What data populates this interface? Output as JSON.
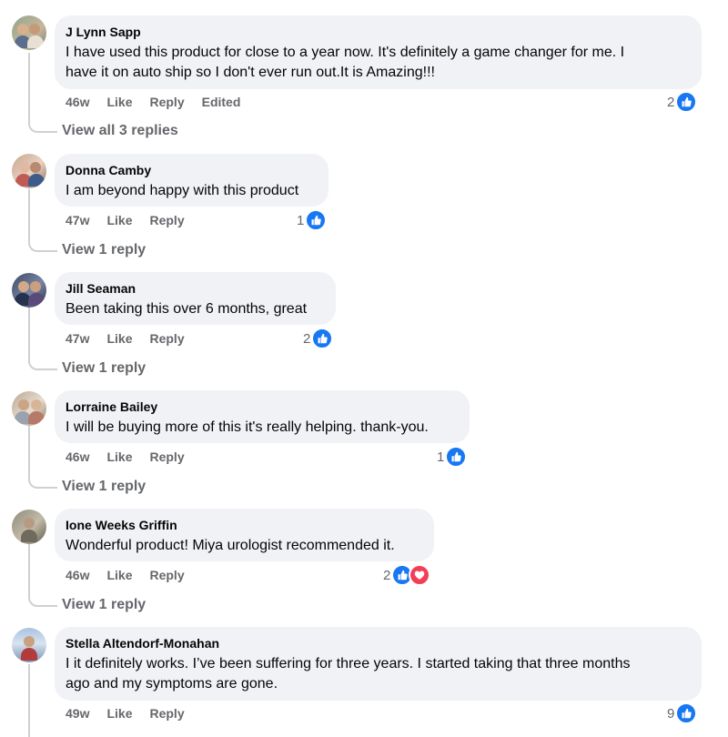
{
  "colors": {
    "like": "#1877f2",
    "love": "#f33e58",
    "meta_text": "#65676b",
    "bubble": "#f0f2f5"
  },
  "action_labels": {
    "like": "Like",
    "reply": "Reply"
  },
  "comments": [
    {
      "author": "J Lynn Sapp",
      "text_lines": [
        "I have used this product for close to a year now. It's definitely a game changer for me. I",
        "have it on auto ship so I don't ever run out.It is Amazing!!!"
      ],
      "time": "46w",
      "edited": "Edited",
      "reactions": "2",
      "reaction_icons": [
        "like-icon"
      ],
      "view_replies": "View all 3 replies"
    },
    {
      "author": "Donna Camby",
      "text_lines": [
        "I am beyond happy with this product"
      ],
      "time": "47w",
      "reactions": "1",
      "reaction_icons": [
        "like-icon"
      ],
      "view_replies": "View 1 reply"
    },
    {
      "author": "Jill Seaman",
      "text_lines": [
        "Been taking this over 6 months, great"
      ],
      "time": "47w",
      "reactions": "2",
      "reaction_icons": [
        "like-icon"
      ],
      "view_replies": "View 1 reply"
    },
    {
      "author": "Lorraine Bailey",
      "text_lines": [
        "I will be buying more of this it's really helping. thank-you."
      ],
      "time": "46w",
      "reactions": "1",
      "reaction_icons": [
        "like-icon"
      ],
      "view_replies": "View 1 reply"
    },
    {
      "author": "Ione Weeks Griffin",
      "text_lines": [
        "Wonderful product! Miya urologist recommended it."
      ],
      "time": "46w",
      "reactions": "2",
      "reaction_icons": [
        "like-icon",
        "heart-icon"
      ],
      "view_replies": "View 1 reply"
    },
    {
      "author": "Stella Altendorf-Monahan",
      "text_lines": [
        "I it definitely works. I’ve been suffering for three years. I started taking that three months",
        "ago and my symptoms are gone."
      ],
      "time": "49w",
      "reactions": "9",
      "reaction_icons": [
        "like-icon"
      ]
    }
  ]
}
